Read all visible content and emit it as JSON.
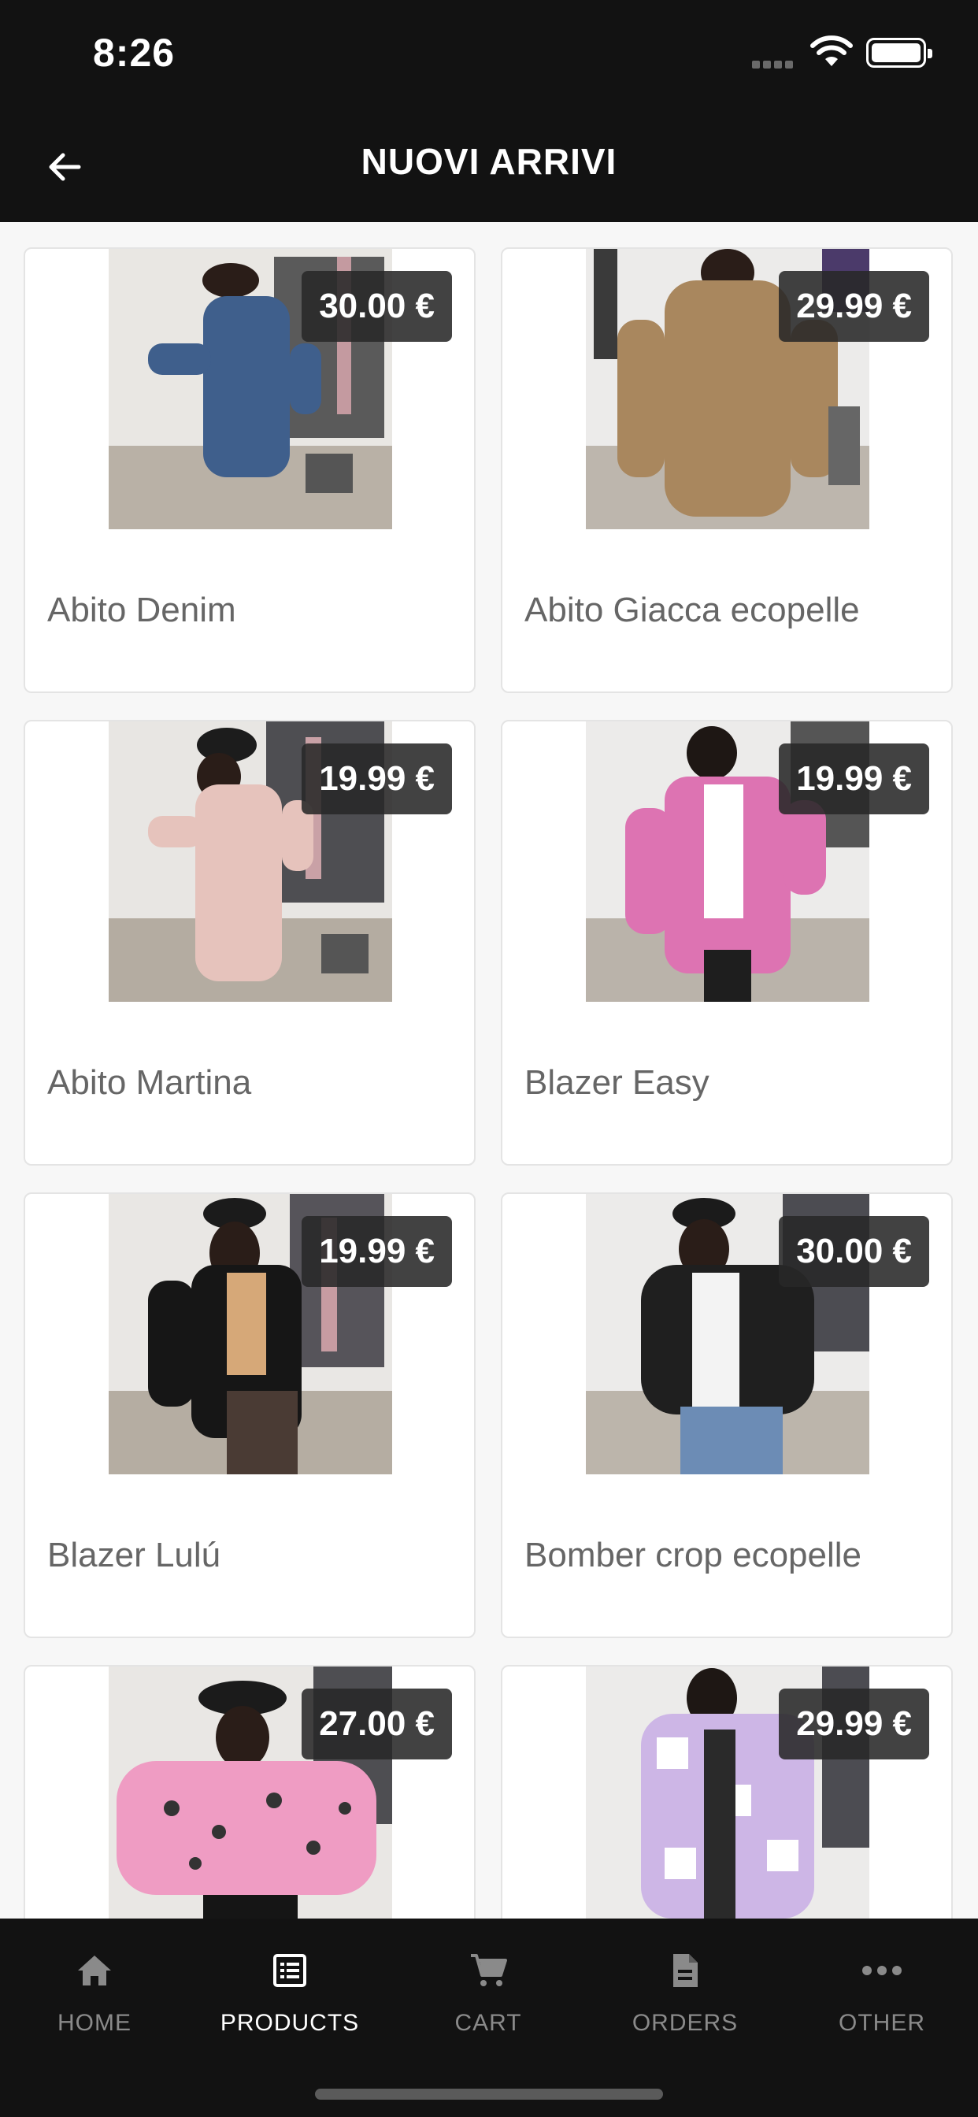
{
  "status": {
    "time": "8:26"
  },
  "header": {
    "title": "NUOVI ARRIVI"
  },
  "products": [
    {
      "name": "Abito Denim",
      "price": "30.00 €"
    },
    {
      "name": "Abito Giacca ecopelle",
      "price": "29.99 €"
    },
    {
      "name": "Abito Martina",
      "price": "19.99 €"
    },
    {
      "name": "Blazer Easy",
      "price": "19.99 €"
    },
    {
      "name": "Blazer Lulú",
      "price": "19.99 €"
    },
    {
      "name": "Bomber crop ecopelle",
      "price": "30.00 €"
    },
    {
      "name": "",
      "price": "27.00 €"
    },
    {
      "name": "",
      "price": "29.99 €"
    }
  ],
  "tabs": [
    {
      "label": "HOME",
      "icon": "home-icon"
    },
    {
      "label": "PRODUCTS",
      "icon": "list-icon"
    },
    {
      "label": "CART",
      "icon": "cart-icon"
    },
    {
      "label": "ORDERS",
      "icon": "document-icon"
    },
    {
      "label": "OTHER",
      "icon": "more-icon"
    }
  ],
  "active_tab": "PRODUCTS"
}
